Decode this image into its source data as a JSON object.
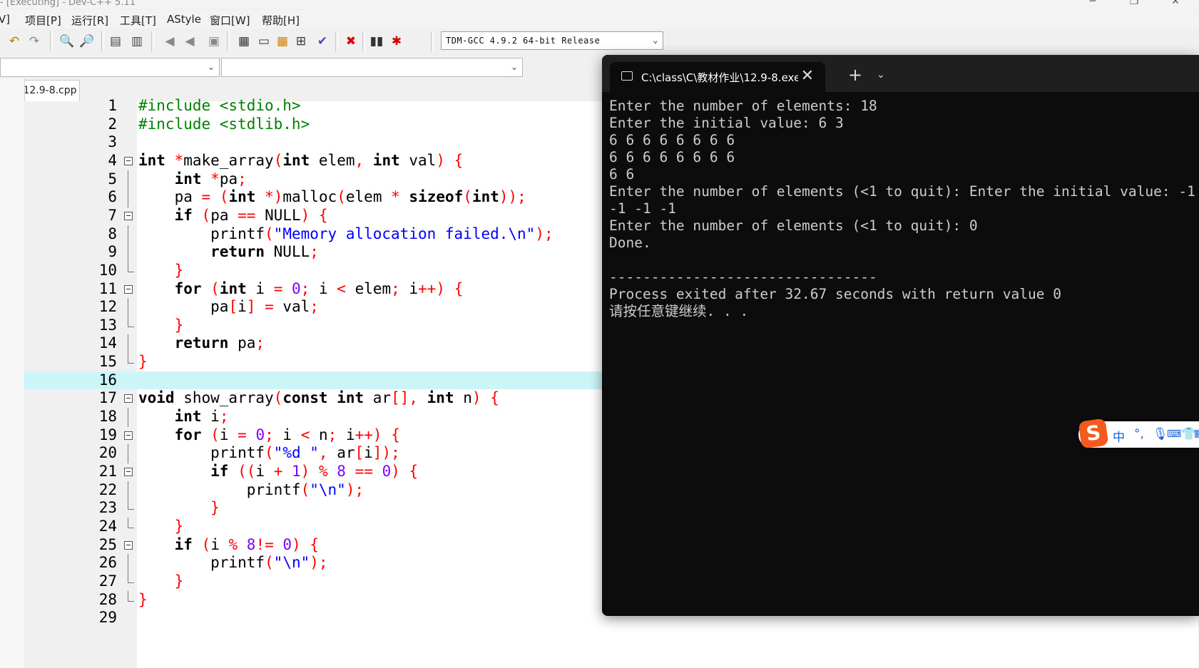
{
  "window": {
    "title": "- [Executing] - Dev-C++ 5.11",
    "controls": {
      "minimize": "─",
      "maximize": "❐",
      "close": "✕"
    }
  },
  "menu": [
    {
      "label": "[V]",
      "left": 0
    },
    {
      "label": "项目[P]"
    },
    {
      "label": "运行[R]"
    },
    {
      "label": "工具[T]"
    },
    {
      "label": "AStyle"
    },
    {
      "label": "窗口[W]"
    },
    {
      "label": "帮助[H]"
    }
  ],
  "toolbar": {
    "icons": [
      "undo-icon",
      "redo-icon",
      "find-icon",
      "replace-icon",
      "indent-icon",
      "unindent-icon",
      "bookmark-prev-icon",
      "bookmark-next-icon",
      "comment-icon",
      "new-class-icon",
      "new-window-icon",
      "project-options-icon",
      "tile-icon",
      "check-icon",
      "abort-icon",
      "profile-icon",
      "debug-icon"
    ],
    "compiler": "TDM-GCC 4.9.2 64-bit Release"
  },
  "editor": {
    "tab": "12.9-8.cpp",
    "current_line": 16,
    "lines": [
      {
        "n": "1",
        "fold": "",
        "seg": [
          [
            "pp",
            "#include <stdio.h>"
          ]
        ]
      },
      {
        "n": "2",
        "fold": "",
        "seg": [
          [
            "pp",
            "#include <stdlib.h>"
          ]
        ]
      },
      {
        "n": "3",
        "fold": "",
        "seg": []
      },
      {
        "n": "4",
        "fold": "open",
        "seg": [
          [
            "kw",
            "int"
          ],
          [
            "id",
            " "
          ],
          [
            "op",
            "*"
          ],
          [
            "id",
            "make_array"
          ],
          [
            "op",
            "("
          ],
          [
            "kw",
            "int"
          ],
          [
            "id",
            " elem"
          ],
          [
            "op",
            ","
          ],
          [
            "id",
            " "
          ],
          [
            "kw",
            "int"
          ],
          [
            "id",
            " val"
          ],
          [
            "op",
            ")"
          ],
          [
            "id",
            " "
          ],
          [
            "op",
            "{"
          ]
        ]
      },
      {
        "n": "5",
        "fold": "line",
        "seg": [
          [
            "id",
            "    "
          ],
          [
            "kw",
            "int"
          ],
          [
            "id",
            " "
          ],
          [
            "op",
            "*"
          ],
          [
            "id",
            "pa"
          ],
          [
            "op",
            ";"
          ]
        ]
      },
      {
        "n": "6",
        "fold": "line",
        "seg": [
          [
            "id",
            "    pa "
          ],
          [
            "op",
            "="
          ],
          [
            "id",
            " "
          ],
          [
            "op",
            "("
          ],
          [
            "kw",
            "int"
          ],
          [
            "id",
            " "
          ],
          [
            "op",
            "*)"
          ],
          [
            "id",
            "malloc"
          ],
          [
            "op",
            "("
          ],
          [
            "id",
            "elem "
          ],
          [
            "op",
            "*"
          ],
          [
            "id",
            " "
          ],
          [
            "kw",
            "sizeof"
          ],
          [
            "op",
            "("
          ],
          [
            "kw",
            "int"
          ],
          [
            "op",
            "));"
          ]
        ]
      },
      {
        "n": "7",
        "fold": "open",
        "seg": [
          [
            "id",
            "    "
          ],
          [
            "kw",
            "if"
          ],
          [
            "id",
            " "
          ],
          [
            "op",
            "("
          ],
          [
            "id",
            "pa "
          ],
          [
            "op",
            "=="
          ],
          [
            "id",
            " NULL"
          ],
          [
            "op",
            ")"
          ],
          [
            "id",
            " "
          ],
          [
            "op",
            "{"
          ]
        ]
      },
      {
        "n": "8",
        "fold": "line",
        "seg": [
          [
            "id",
            "        printf"
          ],
          [
            "op",
            "("
          ],
          [
            "str",
            "\"Memory allocation failed.\\n\""
          ],
          [
            "op",
            ");"
          ]
        ]
      },
      {
        "n": "9",
        "fold": "line",
        "seg": [
          [
            "id",
            "        "
          ],
          [
            "kw",
            "return"
          ],
          [
            "id",
            " NULL"
          ],
          [
            "op",
            ";"
          ]
        ]
      },
      {
        "n": "10",
        "fold": "end",
        "seg": [
          [
            "id",
            "    "
          ],
          [
            "op",
            "}"
          ]
        ]
      },
      {
        "n": "11",
        "fold": "open",
        "seg": [
          [
            "id",
            "    "
          ],
          [
            "kw",
            "for"
          ],
          [
            "id",
            " "
          ],
          [
            "op",
            "("
          ],
          [
            "kw",
            "int"
          ],
          [
            "id",
            " i "
          ],
          [
            "op",
            "="
          ],
          [
            "id",
            " "
          ],
          [
            "num",
            "0"
          ],
          [
            "op",
            ";"
          ],
          [
            "id",
            " i "
          ],
          [
            "op",
            "<"
          ],
          [
            "id",
            " elem"
          ],
          [
            "op",
            ";"
          ],
          [
            "id",
            " i"
          ],
          [
            "op",
            "++)"
          ],
          [
            "id",
            " "
          ],
          [
            "op",
            "{"
          ]
        ]
      },
      {
        "n": "12",
        "fold": "line",
        "seg": [
          [
            "id",
            "        pa"
          ],
          [
            "op",
            "["
          ],
          [
            "id",
            "i"
          ],
          [
            "op",
            "]"
          ],
          [
            "id",
            " "
          ],
          [
            "op",
            "="
          ],
          [
            "id",
            " val"
          ],
          [
            "op",
            ";"
          ]
        ]
      },
      {
        "n": "13",
        "fold": "end",
        "seg": [
          [
            "id",
            "    "
          ],
          [
            "op",
            "}"
          ]
        ]
      },
      {
        "n": "14",
        "fold": "line",
        "seg": [
          [
            "id",
            "    "
          ],
          [
            "kw",
            "return"
          ],
          [
            "id",
            " pa"
          ],
          [
            "op",
            ";"
          ]
        ]
      },
      {
        "n": "15",
        "fold": "end",
        "seg": [
          [
            "op",
            "}"
          ]
        ]
      },
      {
        "n": "16",
        "fold": "",
        "seg": []
      },
      {
        "n": "17",
        "fold": "open",
        "seg": [
          [
            "kw",
            "void"
          ],
          [
            "id",
            " show_array"
          ],
          [
            "op",
            "("
          ],
          [
            "kw",
            "const"
          ],
          [
            "id",
            " "
          ],
          [
            "kw",
            "int"
          ],
          [
            "id",
            " ar"
          ],
          [
            "op",
            "[],"
          ],
          [
            "id",
            " "
          ],
          [
            "kw",
            "int"
          ],
          [
            "id",
            " n"
          ],
          [
            "op",
            ")"
          ],
          [
            "id",
            " "
          ],
          [
            "op",
            "{"
          ]
        ]
      },
      {
        "n": "18",
        "fold": "line",
        "seg": [
          [
            "id",
            "    "
          ],
          [
            "kw",
            "int"
          ],
          [
            "id",
            " i"
          ],
          [
            "op",
            ";"
          ]
        ]
      },
      {
        "n": "19",
        "fold": "open",
        "seg": [
          [
            "id",
            "    "
          ],
          [
            "kw",
            "for"
          ],
          [
            "id",
            " "
          ],
          [
            "op",
            "("
          ],
          [
            "id",
            "i "
          ],
          [
            "op",
            "="
          ],
          [
            "id",
            " "
          ],
          [
            "num",
            "0"
          ],
          [
            "op",
            ";"
          ],
          [
            "id",
            " i "
          ],
          [
            "op",
            "<"
          ],
          [
            "id",
            " n"
          ],
          [
            "op",
            ";"
          ],
          [
            "id",
            " i"
          ],
          [
            "op",
            "++)"
          ],
          [
            "id",
            " "
          ],
          [
            "op",
            "{"
          ]
        ]
      },
      {
        "n": "20",
        "fold": "line",
        "seg": [
          [
            "id",
            "        printf"
          ],
          [
            "op",
            "("
          ],
          [
            "str",
            "\"%d \""
          ],
          [
            "op",
            ","
          ],
          [
            "id",
            " ar"
          ],
          [
            "op",
            "["
          ],
          [
            "id",
            "i"
          ],
          [
            "op",
            "]);"
          ]
        ]
      },
      {
        "n": "21",
        "fold": "open",
        "seg": [
          [
            "id",
            "        "
          ],
          [
            "kw",
            "if"
          ],
          [
            "id",
            " "
          ],
          [
            "op",
            "(("
          ],
          [
            "id",
            "i "
          ],
          [
            "op",
            "+"
          ],
          [
            "id",
            " "
          ],
          [
            "num",
            "1"
          ],
          [
            "op",
            ")"
          ],
          [
            "id",
            " "
          ],
          [
            "op",
            "%"
          ],
          [
            "id",
            " "
          ],
          [
            "num",
            "8"
          ],
          [
            "id",
            " "
          ],
          [
            "op",
            "=="
          ],
          [
            "id",
            " "
          ],
          [
            "num",
            "0"
          ],
          [
            "op",
            ")"
          ],
          [
            "id",
            " "
          ],
          [
            "op",
            "{"
          ]
        ]
      },
      {
        "n": "22",
        "fold": "line",
        "seg": [
          [
            "id",
            "            printf"
          ],
          [
            "op",
            "("
          ],
          [
            "str",
            "\"\\n\""
          ],
          [
            "op",
            ");"
          ]
        ]
      },
      {
        "n": "23",
        "fold": "end",
        "seg": [
          [
            "id",
            "        "
          ],
          [
            "op",
            "}"
          ]
        ]
      },
      {
        "n": "24",
        "fold": "end",
        "seg": [
          [
            "id",
            "    "
          ],
          [
            "op",
            "}"
          ]
        ]
      },
      {
        "n": "25",
        "fold": "open",
        "seg": [
          [
            "id",
            "    "
          ],
          [
            "kw",
            "if"
          ],
          [
            "id",
            " "
          ],
          [
            "op",
            "("
          ],
          [
            "id",
            "i "
          ],
          [
            "op",
            "%"
          ],
          [
            "id",
            " "
          ],
          [
            "num",
            "8"
          ],
          [
            "op",
            "!="
          ],
          [
            "id",
            " "
          ],
          [
            "num",
            "0"
          ],
          [
            "op",
            ")"
          ],
          [
            "id",
            " "
          ],
          [
            "op",
            "{"
          ]
        ]
      },
      {
        "n": "26",
        "fold": "line",
        "seg": [
          [
            "id",
            "        printf"
          ],
          [
            "op",
            "("
          ],
          [
            "str",
            "\"\\n\""
          ],
          [
            "op",
            ");"
          ]
        ]
      },
      {
        "n": "27",
        "fold": "end",
        "seg": [
          [
            "id",
            "    "
          ],
          [
            "op",
            "}"
          ]
        ]
      },
      {
        "n": "28",
        "fold": "end",
        "seg": [
          [
            "op",
            "}"
          ]
        ]
      },
      {
        "n": "29",
        "fold": "",
        "seg": []
      }
    ]
  },
  "console": {
    "tab_title": "C:\\class\\C\\教材作业\\12.9-8.exe",
    "new_tab": "+",
    "dropdown": "⌄",
    "close": "✕",
    "output": "Enter the number of elements: 18\nEnter the initial value: 6 3\n6 6 6 6 6 6 6 6\n6 6 6 6 6 6 6 6\n6 6\nEnter the number of elements (<1 to quit): Enter the initial value: -1\n-1 -1 -1\nEnter the number of elements (<1 to quit): 0\nDone.\n\n--------------------------------\nProcess exited after 32.67 seconds with return value 0\n请按任意键继续. . ."
  },
  "ime": {
    "logo": "S",
    "mode": "中",
    "punct": "°,",
    "icons": [
      "mic-icon",
      "keyboard-icon",
      "skin-icon",
      "toolbox-icon"
    ]
  },
  "colors": {
    "keyword": "#000000",
    "preprocessor": "#008000",
    "operator": "#ff0000",
    "string": "#0000ff",
    "number": "#8000ff",
    "current_line": "#ccf5f7",
    "console_bg": "#0c0c0c"
  }
}
